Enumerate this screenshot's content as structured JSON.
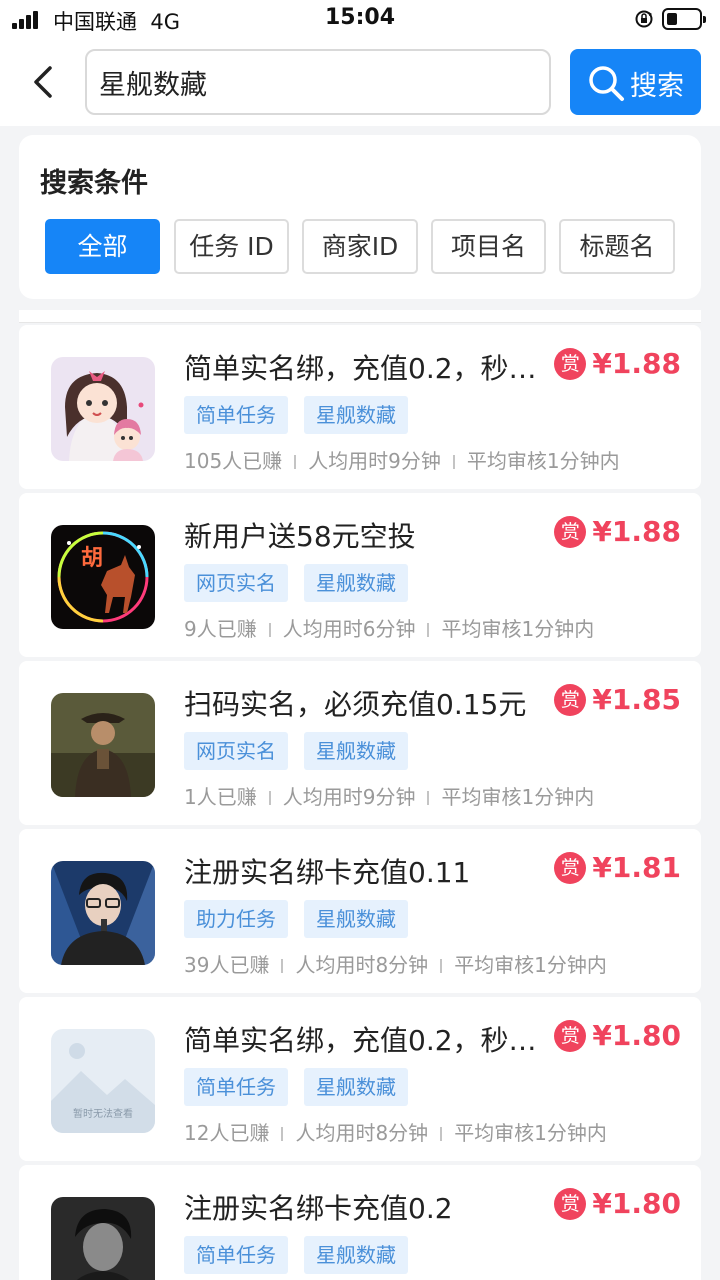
{
  "status_bar": {
    "carrier": "中国联通",
    "network": "4G",
    "time": "15:04"
  },
  "header": {
    "search_value": "星舰数藏",
    "search_button": "搜索"
  },
  "filter": {
    "title": "搜索条件",
    "options": [
      "全部",
      "任务 ID",
      "商家ID",
      "项目名",
      "标题名"
    ],
    "selected": "全部"
  },
  "tasks": [
    {
      "title": "简单实名绑，充值0.2，秒…",
      "reward_badge": "赏",
      "price": "¥1.88",
      "tags": [
        "简单任务",
        "星舰数藏"
      ],
      "earned": "105人已赚",
      "avg_time": "人均用时9分钟",
      "review": "平均审核1分钟内",
      "thumb": "cartoon-girl"
    },
    {
      "title": "新用户送58元空投",
      "reward_badge": "赏",
      "price": "¥1.88",
      "tags": [
        "网页实名",
        "星舰数藏"
      ],
      "earned": "9人已赚",
      "avg_time": "人均用时6分钟",
      "review": "平均审核1分钟内",
      "thumb": "neon-goat"
    },
    {
      "title": "扫码实名，必须充值0.15元",
      "reward_badge": "赏",
      "price": "¥1.85",
      "tags": [
        "网页实名",
        "星舰数藏"
      ],
      "earned": "1人已赚",
      "avg_time": "人均用时9分钟",
      "review": "平均审核1分钟内",
      "thumb": "cowboy-photo"
    },
    {
      "title": "注册实名绑卡充值0.11",
      "reward_badge": "赏",
      "price": "¥1.81",
      "tags": [
        "助力任务",
        "星舰数藏"
      ],
      "earned": "39人已赚",
      "avg_time": "人均用时8分钟",
      "review": "平均审核1分钟内",
      "thumb": "singer-photo"
    },
    {
      "title": "简单实名绑，充值0.2，秒…",
      "reward_badge": "赏",
      "price": "¥1.80",
      "tags": [
        "简单任务",
        "星舰数藏"
      ],
      "earned": "12人已赚",
      "avg_time": "人均用时8分钟",
      "review": "平均审核1分钟内",
      "thumb": "image-placeholder",
      "placeholder_text": "暂时无法查看"
    },
    {
      "title": "注册实名绑卡充值0.2",
      "reward_badge": "赏",
      "price": "¥1.80",
      "tags": [
        "简单任务",
        "星舰数藏"
      ],
      "thumb": "dark-portrait"
    }
  ]
}
